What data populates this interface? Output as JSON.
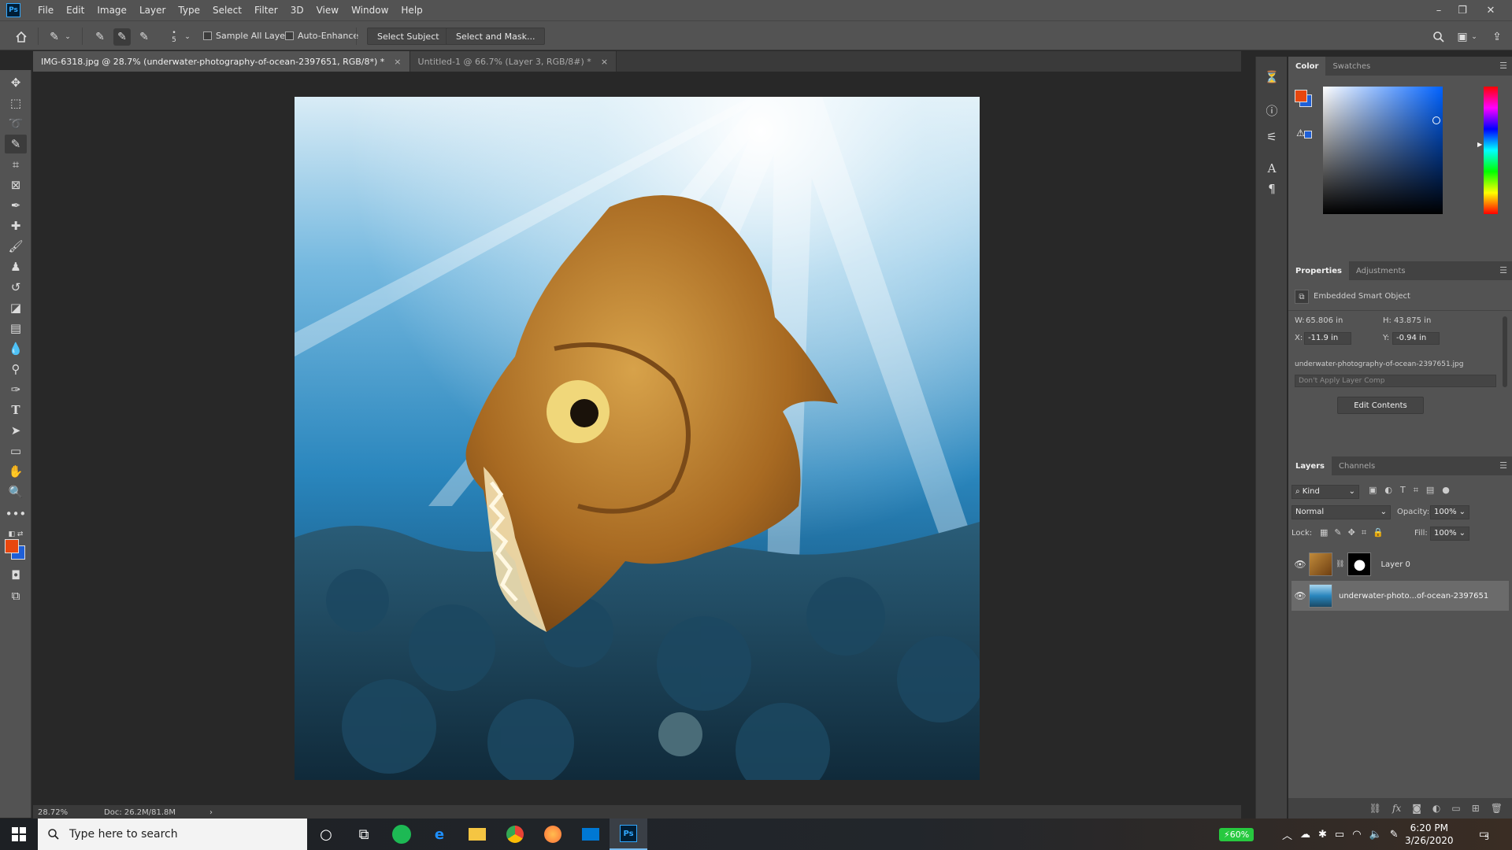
{
  "app": {
    "logo": "Ps",
    "menu": [
      "File",
      "Edit",
      "Image",
      "Layer",
      "Type",
      "Select",
      "Filter",
      "3D",
      "View",
      "Window",
      "Help"
    ]
  },
  "options_bar": {
    "brush_size": "5",
    "sample_all_layers": "Sample All Layers",
    "auto_enhance": "Auto-Enhance",
    "select_subject": "Select Subject",
    "select_and_mask": "Select and Mask..."
  },
  "tabs": [
    {
      "label": "IMG-6318.jpg @ 28.7% (underwater-photography-of-ocean-2397651, RGB/8*) *",
      "close": "×"
    },
    {
      "label": "Untitled-1 @ 66.7% (Layer 3, RGB/8#) *",
      "close": "×"
    }
  ],
  "status": {
    "zoom": "28.72%",
    "doc": "Doc: 26.2M/81.8M",
    "arrow": "›"
  },
  "color_panel": {
    "tabs": [
      "Color",
      "Swatches"
    ],
    "foreground": "#e8470e",
    "background": "#1f5fd6"
  },
  "properties": {
    "tabs": [
      "Properties",
      "Adjustments"
    ],
    "type": "Embedded Smart Object",
    "w_label": "W:",
    "w_value": "65.806 in",
    "h_label": "H:",
    "h_value": "43.875 in",
    "x_label": "X:",
    "x_value": "-11.9 in",
    "y_label": "Y:",
    "y_value": "-0.94 in",
    "filename": "underwater-photography-of-ocean-2397651.jpg",
    "layer_comp": "Don't Apply Layer Comp",
    "edit_contents": "Edit Contents"
  },
  "layers": {
    "tabs": [
      "Layers",
      "Channels"
    ],
    "filter": "Kind",
    "blend_mode": "Normal",
    "opacity_label": "Opacity:",
    "opacity": "100%",
    "lock_label": "Lock:",
    "fill_label": "Fill:",
    "fill": "100%",
    "items": [
      {
        "name": "Layer 0"
      },
      {
        "name": "underwater-photo...of-ocean-2397651"
      }
    ]
  },
  "taskbar": {
    "search_placeholder": "Type here to search",
    "battery": "60%",
    "time": "6:20 PM",
    "date": "3/26/2020",
    "notifications": "5"
  }
}
